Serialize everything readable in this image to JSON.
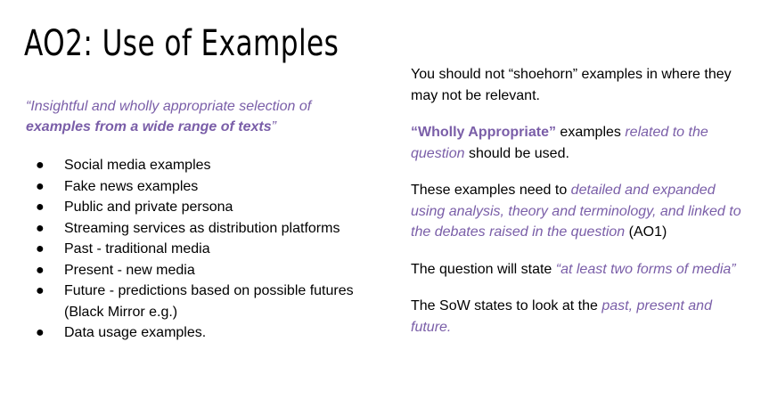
{
  "title": "AO2: Use of Examples",
  "quote": {
    "part1": "“Insightful and wholly appropriate selection of ",
    "part2_bold": "examples from a wide range of texts",
    "part3": "”"
  },
  "bullets": [
    "Social media examples",
    "Fake news examples",
    "Public and private persona",
    "Streaming services as distribution platforms",
    "Past - traditional media",
    "Present - new media",
    "Future - predictions based on possible futures (Black Mirror e.g.)",
    "Data usage examples."
  ],
  "right": {
    "p1": "You should not  “shoehorn” examples in where they may not be relevant.",
    "p2": {
      "bold_purple": "“Wholly Appropriate”",
      "plain1": " examples ",
      "italic_purple": "related to the question",
      "plain2": " should be used."
    },
    "p3": {
      "plain1": "These examples need to ",
      "italic_purple": "detailed and expanded using analysis, theory and terminology, and linked to the debates raised in the question",
      "plain2": " (AO1)"
    },
    "p4": {
      "plain1": "The question will state ",
      "italic_purple": "“at least two forms of media”"
    },
    "p5": {
      "plain1": "The SoW states to look at the ",
      "italic_purple": "past, present and future."
    }
  },
  "colors": {
    "accent": "#7a5ea8",
    "text": "#000000",
    "background": "#ffffff"
  }
}
